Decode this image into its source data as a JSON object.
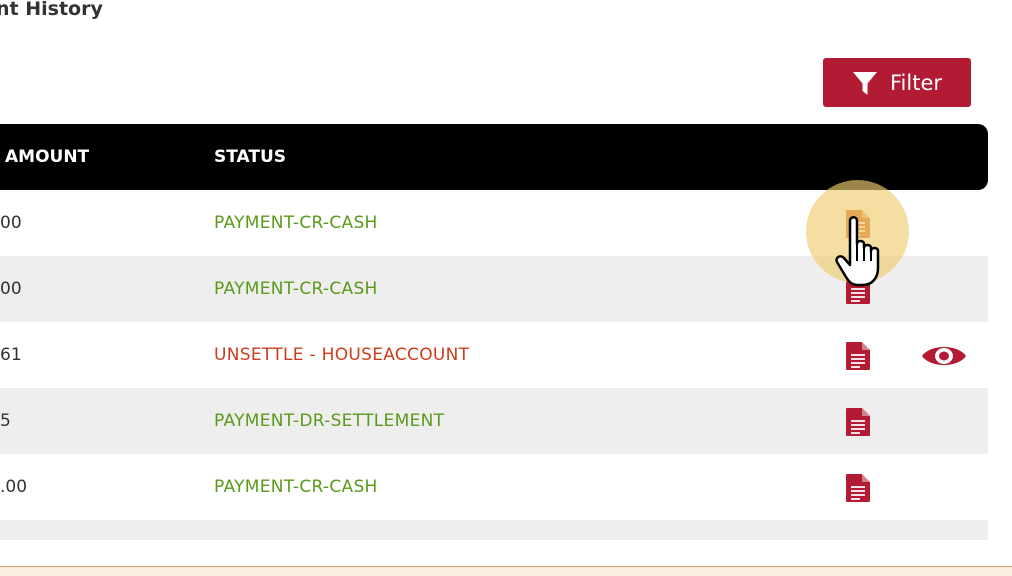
{
  "page": {
    "title": "nt History"
  },
  "toolbar": {
    "filter_label": "Filter",
    "filter_icon": "funnel-icon"
  },
  "table": {
    "columns": [
      "AMOUNT",
      "STATUS"
    ],
    "rows": [
      {
        "amount": "00",
        "status": "PAYMENT-CR-CASH",
        "status_color": "#5a9a1a",
        "has_view": false,
        "doc_highlighted": true
      },
      {
        "amount": "00",
        "status": "PAYMENT-CR-CASH",
        "status_color": "#5a9a1a",
        "has_view": false
      },
      {
        "amount": "61",
        "status": "UNSETTLE - HOUSEACCOUNT",
        "status_color": "#cc3d1c",
        "has_view": true
      },
      {
        "amount": "5",
        "status": "PAYMENT-DR-SETTLEMENT",
        "status_color": "#5a9a1a",
        "has_view": false
      },
      {
        "amount": ".00",
        "status": "PAYMENT-CR-CASH",
        "status_color": "#5a9a1a",
        "has_view": false
      },
      {
        "amount": "",
        "status": "",
        "status_color": "#5a9a1a",
        "has_view": false
      }
    ],
    "doc_icon": "document-icon",
    "view_icon": "eye-icon"
  },
  "colors": {
    "accent": "#b31b34",
    "header_bg": "#000000",
    "row_alt_bg": "#eeeeee",
    "doc_icon": "#b31b34",
    "doc_icon_highlighted": "#d66a2b",
    "status_ok": "#5a9a1a",
    "status_warn": "#cc3d1c"
  }
}
